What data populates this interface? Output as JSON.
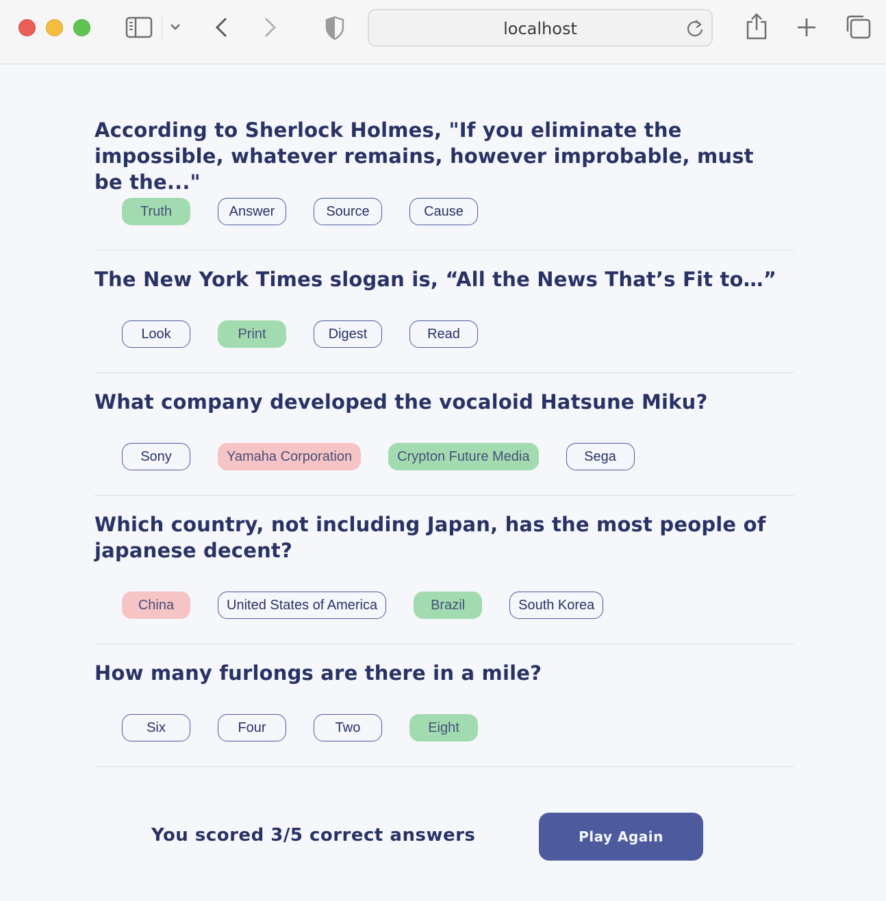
{
  "browser": {
    "url": "localhost",
    "icons": [
      "sidebar-icon",
      "chevron-down-icon",
      "back-icon",
      "forward-icon",
      "shield-icon",
      "reload-icon",
      "share-icon",
      "new-tab-icon",
      "tabs-overview-icon"
    ]
  },
  "questions": [
    {
      "text": "According to Sherlock Holmes, \"If you eliminate the impossible, whatever remains, however improbable, must be the...\"",
      "answers": [
        {
          "label": "Truth",
          "state": "correct"
        },
        {
          "label": "Answer",
          "state": "neutral"
        },
        {
          "label": "Source",
          "state": "neutral"
        },
        {
          "label": "Cause",
          "state": "neutral"
        }
      ]
    },
    {
      "text": "The New York Times slogan is, “All the News That’s Fit to…”",
      "answers": [
        {
          "label": "Look",
          "state": "neutral"
        },
        {
          "label": "Print",
          "state": "correct"
        },
        {
          "label": "Digest",
          "state": "neutral"
        },
        {
          "label": "Read",
          "state": "neutral"
        }
      ]
    },
    {
      "text": "What company developed the vocaloid Hatsune Miku?",
      "answers": [
        {
          "label": "Sony",
          "state": "neutral"
        },
        {
          "label": "Yamaha Corporation",
          "state": "wrong"
        },
        {
          "label": "Crypton Future Media",
          "state": "correct"
        },
        {
          "label": "Sega",
          "state": "neutral"
        }
      ]
    },
    {
      "text": "Which country, not including Japan, has the most people of japanese decent?",
      "answers": [
        {
          "label": "China",
          "state": "wrong"
        },
        {
          "label": "United States of America",
          "state": "neutral"
        },
        {
          "label": "Brazil",
          "state": "correct"
        },
        {
          "label": "South Korea",
          "state": "neutral"
        }
      ]
    },
    {
      "text": "How many furlongs are there in a mile?",
      "answers": [
        {
          "label": "Six",
          "state": "neutral"
        },
        {
          "label": "Four",
          "state": "neutral"
        },
        {
          "label": "Two",
          "state": "neutral"
        },
        {
          "label": "Eight",
          "state": "correct"
        }
      ]
    }
  ],
  "result": {
    "score_text": "You scored 3/5 correct answers",
    "play_again_label": "Play Again"
  },
  "colors": {
    "correct": "#94d7a2",
    "wrong": "#f8bcbc",
    "primary": "#4d5b9e",
    "text": "#293264",
    "background": "#f5f7fb"
  }
}
